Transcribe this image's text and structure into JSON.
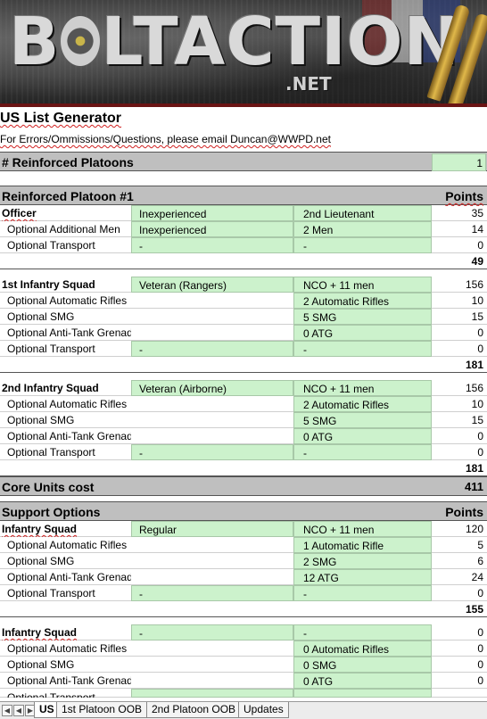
{
  "banner": {
    "logo_b": "B",
    "logo_rest": "LTACTION",
    "logo_net": ".NET"
  },
  "header": {
    "title": "US List Generator",
    "subtitle": "For Errors/Ommissions/Questions, please email Duncan@WWPD.net"
  },
  "platoons": {
    "label": "# Reinforced Platoons",
    "value": "1"
  },
  "platoon1": {
    "heading": "Reinforced Platoon #1",
    "points_label": "Points",
    "officer": {
      "label": "Officer",
      "experience": "Inexperienced",
      "rank": "2nd Lieutenant",
      "points": "35"
    },
    "additional_men": {
      "label": "Optional Additional Men",
      "experience": "Inexperienced",
      "count": "2 Men",
      "points": "14"
    },
    "officer_transport": {
      "label": "Optional Transport",
      "c1": "-",
      "c2": "-",
      "points": "0"
    },
    "officer_total": "49",
    "squad1": {
      "label": "1st Infantry Squad",
      "experience": "Veteran (Rangers)",
      "size": "NCO + 11 men",
      "points": "156",
      "rifles": {
        "label": "Optional Automatic Rifles",
        "value": "2 Automatic Rifles",
        "points": "10"
      },
      "smg": {
        "label": "Optional SMG",
        "value": "5 SMG",
        "points": "15"
      },
      "atg": {
        "label": "Optional Anti-Tank Grenades",
        "value": "0 ATG",
        "points": "0"
      },
      "transport": {
        "label": "Optional Transport",
        "c1": "-",
        "c2": "-",
        "points": "0"
      },
      "total": "181"
    },
    "squad2": {
      "label": "2nd Infantry Squad",
      "experience": "Veteran (Airborne)",
      "size": "NCO + 11 men",
      "points": "156",
      "rifles": {
        "label": "Optional Automatic Rifles",
        "value": "2 Automatic Rifles",
        "points": "10"
      },
      "smg": {
        "label": "Optional SMG",
        "value": "5 SMG",
        "points": "15"
      },
      "atg": {
        "label": "Optional Anti-Tank Grenades",
        "value": "0 ATG",
        "points": "0"
      },
      "transport": {
        "label": "Optional Transport",
        "c1": "-",
        "c2": "-",
        "points": "0"
      },
      "total": "181"
    }
  },
  "core": {
    "label": "Core Units cost",
    "value": "411"
  },
  "support": {
    "heading": "Support Options",
    "points_label": "Points",
    "squadA": {
      "label": "Infantry Squad",
      "experience": "Regular",
      "size": "NCO + 11 men",
      "points": "120",
      "rifles": {
        "label": "Optional Automatic Rifles",
        "value": "1 Automatic Rifle",
        "points": "5"
      },
      "smg": {
        "label": "Optional SMG",
        "value": "2 SMG",
        "points": "6"
      },
      "atg": {
        "label": "Optional Anti-Tank Grenades",
        "value": "12 ATG",
        "points": "24"
      },
      "transport": {
        "label": "Optional Transport",
        "c1": "-",
        "c2": "-",
        "points": "0"
      },
      "total": "155"
    },
    "squadB": {
      "label": "Infantry Squad",
      "experience": "-",
      "size": "-",
      "points": "0",
      "rifles": {
        "label": "Optional Automatic Rifles",
        "value": "0 Automatic Rifles",
        "points": "0"
      },
      "smg": {
        "label": "Optional SMG",
        "value": "0 SMG",
        "points": "0"
      },
      "atg": {
        "label": "Optional Anti-Tank Grenades",
        "value": "0 ATG",
        "points": "0"
      },
      "transport": {
        "label": "Optional Transport"
      }
    }
  },
  "tabs": [
    {
      "label": "US"
    },
    {
      "label": "1st Platoon OOB"
    },
    {
      "label": "2nd Platoon OOB"
    },
    {
      "label": "Updates"
    }
  ]
}
